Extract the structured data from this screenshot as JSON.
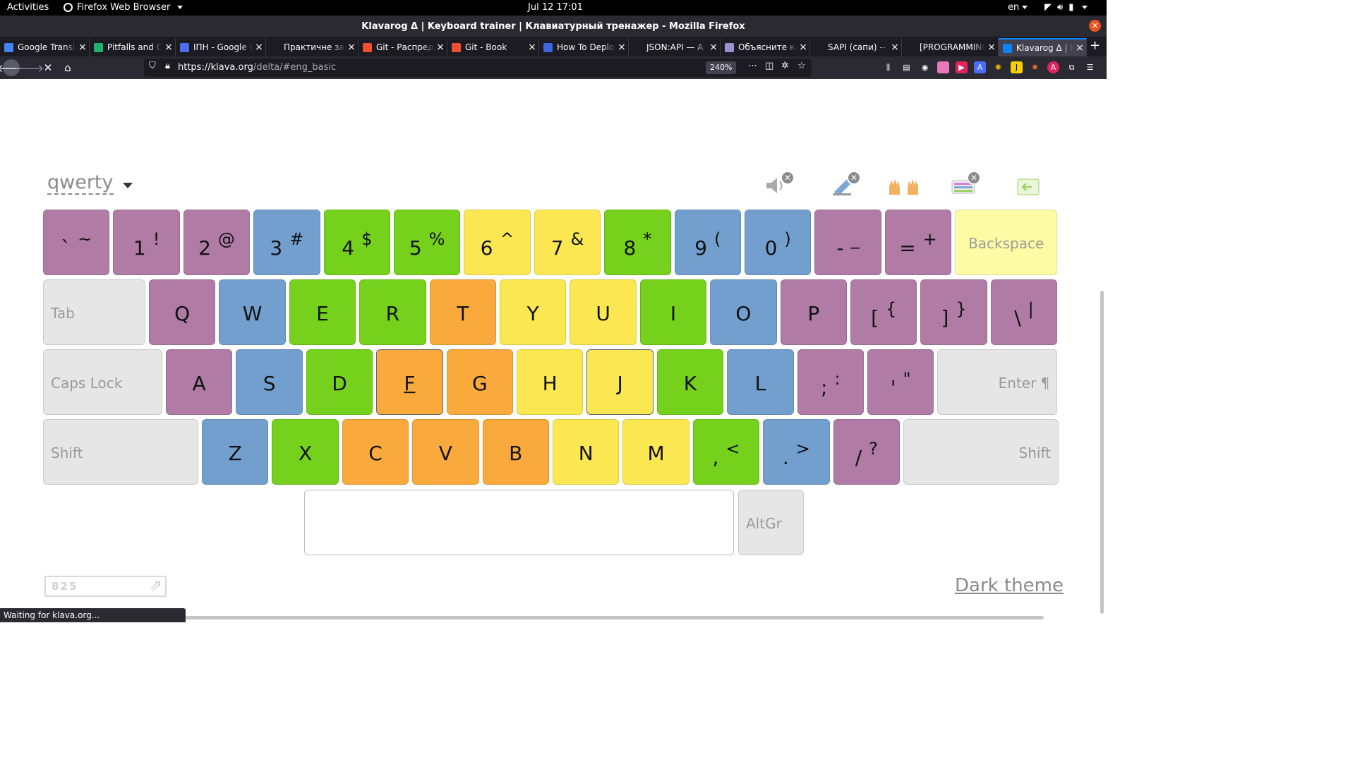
{
  "system": {
    "activities": "Activities",
    "app_menu": "Firefox Web Browser",
    "clock": "Jul 12  17:01",
    "lang": "en"
  },
  "window": {
    "title": "Klavarog Δ | Keyboard trainer | Клавиатурный тренажер - Mozilla Firefox"
  },
  "tabs": [
    {
      "label": "Google Translate",
      "color": "#4285f4"
    },
    {
      "label": "Pitfalls and Common",
      "color": "#21b36b"
    },
    {
      "label": "ІПН - Google Docs",
      "color": "#4c6ef5"
    },
    {
      "label": "Практичне завдання",
      "color": "#1c1b22"
    },
    {
      "label": "Git - Распределённый",
      "color": "#f14e32"
    },
    {
      "label": "Git - Book",
      "color": "#f14e32"
    },
    {
      "label": "How To Deploy",
      "color": "#3b66e0"
    },
    {
      "label": "JSON:API — A",
      "color": "#1c1b22"
    },
    {
      "label": "Объясните как",
      "color": "#9b8fd4"
    },
    {
      "label": "SAPI (сапи) -- что",
      "color": "#1c1b22"
    },
    {
      "label": "[PROGRAMMING]",
      "color": "#1c1b22"
    },
    {
      "label": "Klavarog Δ | Keyboard",
      "color": "#0a84ff"
    }
  ],
  "nav": {
    "url_host": "https://klava.org",
    "url_path": "/delta/#eng_basic",
    "zoom": "240%"
  },
  "trainer": {
    "layout": "qwerty",
    "dark_theme": "Dark theme",
    "counter": "825"
  },
  "keyboard": {
    "rows": [
      [
        {
          "a": "`",
          "b": "~",
          "color": "purple"
        },
        {
          "a": "1",
          "b": "!",
          "color": "purple"
        },
        {
          "a": "2",
          "b": "@",
          "color": "purple"
        },
        {
          "a": "3",
          "b": "#",
          "color": "blue"
        },
        {
          "a": "4",
          "b": "$",
          "color": "green"
        },
        {
          "a": "5",
          "b": "%",
          "color": "green"
        },
        {
          "a": "6",
          "b": "^",
          "color": "yellow"
        },
        {
          "a": "7",
          "b": "&",
          "color": "yellow"
        },
        {
          "a": "8",
          "b": "*",
          "color": "green"
        },
        {
          "a": "9",
          "b": "(",
          "color": "blue"
        },
        {
          "a": "0",
          "b": ")",
          "color": "blue"
        },
        {
          "a": "-",
          "b": "_",
          "color": "purple"
        },
        {
          "a": "=",
          "b": "+",
          "color": "purple"
        },
        {
          "label": "Backspace",
          "color": "back"
        }
      ],
      [
        {
          "label": "Tab",
          "color": "fn"
        },
        {
          "k": "Q",
          "color": "purple"
        },
        {
          "k": "W",
          "color": "blue"
        },
        {
          "k": "E",
          "color": "green"
        },
        {
          "k": "R",
          "color": "green"
        },
        {
          "k": "T",
          "color": "orange"
        },
        {
          "k": "Y",
          "color": "yellow"
        },
        {
          "k": "U",
          "color": "yellow"
        },
        {
          "k": "I",
          "color": "green"
        },
        {
          "k": "O",
          "color": "blue"
        },
        {
          "k": "P",
          "color": "purple"
        },
        {
          "a": "[",
          "b": "{",
          "color": "purple"
        },
        {
          "a": "]",
          "b": "}",
          "color": "purple"
        },
        {
          "a": "\\",
          "b": "|",
          "color": "purple"
        }
      ],
      [
        {
          "label": "Caps Lock",
          "color": "fn"
        },
        {
          "k": "A",
          "color": "purple"
        },
        {
          "k": "S",
          "color": "blue"
        },
        {
          "k": "D",
          "color": "green"
        },
        {
          "k": "F",
          "color": "orange"
        },
        {
          "k": "G",
          "color": "orange"
        },
        {
          "k": "H",
          "color": "yellow"
        },
        {
          "k": "J",
          "color": "yellow"
        },
        {
          "k": "K",
          "color": "green"
        },
        {
          "k": "L",
          "color": "blue"
        },
        {
          "a": ";",
          "b": ":",
          "color": "purple"
        },
        {
          "a": "'",
          "b": "\"",
          "color": "purple"
        },
        {
          "label": "Enter ¶",
          "color": "fn"
        }
      ],
      [
        {
          "label": "Shift",
          "color": "fn"
        },
        {
          "k": "Z",
          "color": "blue"
        },
        {
          "k": "X",
          "color": "green"
        },
        {
          "k": "C",
          "color": "orange"
        },
        {
          "k": "V",
          "color": "orange"
        },
        {
          "k": "B",
          "color": "orange"
        },
        {
          "k": "N",
          "color": "yellow"
        },
        {
          "k": "M",
          "color": "yellow"
        },
        {
          "a": ",",
          "b": "<",
          "color": "green"
        },
        {
          "a": ".",
          "b": ">",
          "color": "blue"
        },
        {
          "a": "/",
          "b": "?",
          "color": "purple"
        },
        {
          "label": "Shift",
          "color": "fn"
        }
      ],
      [
        {
          "label": "",
          "color": "space"
        },
        {
          "label": "AltGr",
          "color": "fn"
        }
      ]
    ]
  },
  "status": {
    "text": "Waiting for klava.org..."
  }
}
